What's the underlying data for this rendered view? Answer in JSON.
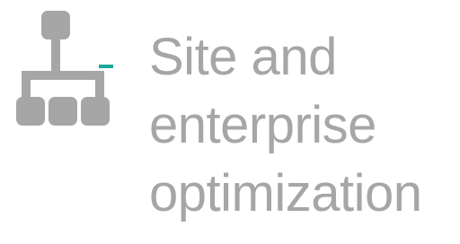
{
  "icon": {
    "name": "hierarchy-network-icon",
    "color": "#a6a6a6",
    "accent_color": "#1aa99a"
  },
  "title": {
    "lines": [
      "Site and",
      "enterprise",
      "optimization"
    ],
    "color": "#a6a6a6"
  }
}
